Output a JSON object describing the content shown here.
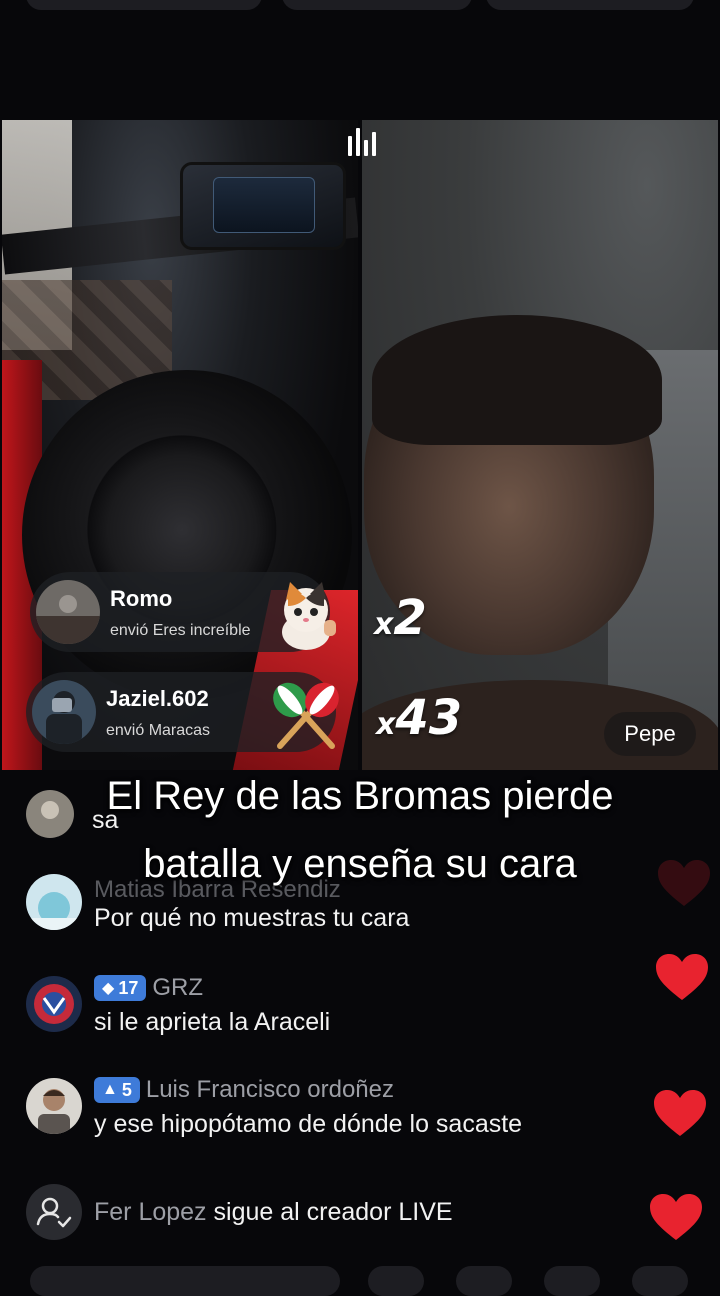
{
  "battle": {
    "left_gifts": [
      {
        "user": "Romo",
        "desc": "envió Eres increíble",
        "multiplier_prefix": "x",
        "multiplier": "2",
        "gift_icon": "cat-thumbs-up-icon"
      },
      {
        "user": "Jaziel.602",
        "desc": "envió Maracas",
        "multiplier_prefix": "x",
        "multiplier": "43",
        "gift_icon": "maracas-icon"
      }
    ],
    "right_name": "Pepe"
  },
  "caption": {
    "line1": "El Rey de las Bromas pierde",
    "line2": "batalla y enseña su cara"
  },
  "comments": [
    {
      "user": "",
      "text": "sa"
    },
    {
      "user": "Matias Ibarra Resendiz",
      "text": "Por qué no muestras tu cara"
    },
    {
      "user": "GRZ",
      "badge": "17",
      "badge_icon": "diamond-icon",
      "text": "si le aprieta la Araceli"
    },
    {
      "user": "Luis Francisco ordoñez",
      "badge": "5",
      "badge_icon": "triangle-icon",
      "text": "y ese hipopótamo de dónde lo sacaste"
    }
  ],
  "follow_event": {
    "user": "Fer Lopez",
    "text": "sigue al creador LIVE",
    "icon": "follow-user-icon"
  },
  "colors": {
    "heart": "#e8232f",
    "badge": "#3e7bd9",
    "background": "#07070a"
  }
}
